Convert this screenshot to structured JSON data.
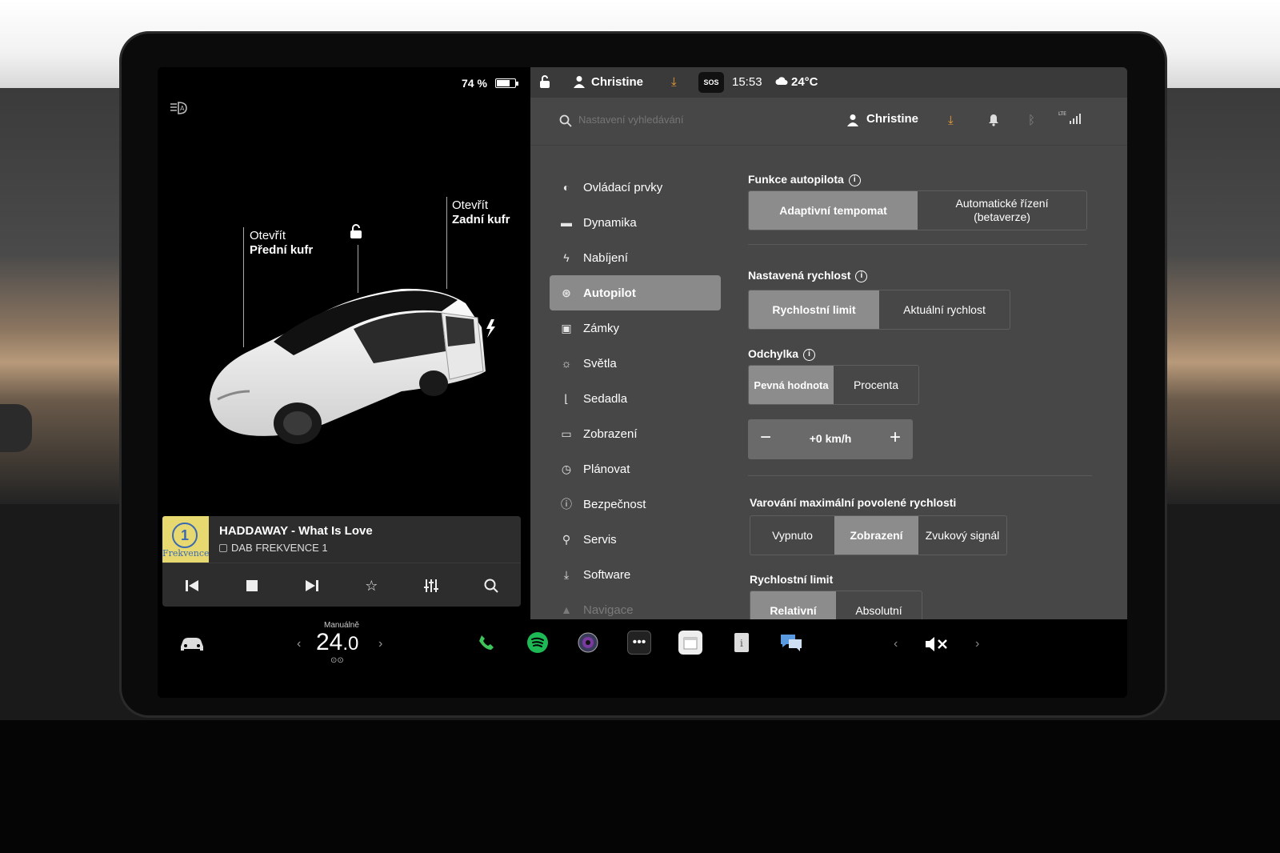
{
  "status": {
    "battery_percent": "74 %",
    "battery_level": 0.74,
    "user": "Christine",
    "sos": "SOS",
    "time": "15:53",
    "outside_temp": "24°C"
  },
  "car_view": {
    "front_trunk": {
      "action": "Otevřít",
      "name": "Přední kufr"
    },
    "rear_trunk": {
      "action": "Otevřít",
      "name": "Zadní kufr"
    }
  },
  "media": {
    "art_logo": "1",
    "art_brand": "Frekvence",
    "title": "HADDAWAY - What Is Love",
    "station": "DAB FREKVENCE 1"
  },
  "search": {
    "placeholder": "Nastavení vyhledávání"
  },
  "header": {
    "user": "Christine",
    "lte": "LTE"
  },
  "nav": [
    {
      "label": "Ovládací prvky",
      "icon": "toggle-icon"
    },
    {
      "label": "Dynamika",
      "icon": "car-icon"
    },
    {
      "label": "Nabíjení",
      "icon": "bolt-icon"
    },
    {
      "label": "Autopilot",
      "icon": "steering-wheel-icon",
      "active": true
    },
    {
      "label": "Zámky",
      "icon": "lock-icon"
    },
    {
      "label": "Světla",
      "icon": "sun-icon"
    },
    {
      "label": "Sedadla",
      "icon": "seat-icon"
    },
    {
      "label": "Zobrazení",
      "icon": "display-icon"
    },
    {
      "label": "Plánovat",
      "icon": "alarm-clock-icon"
    },
    {
      "label": "Bezpečnost",
      "icon": "shield-alert-icon"
    },
    {
      "label": "Servis",
      "icon": "wrench-icon"
    },
    {
      "label": "Software",
      "icon": "download-icon"
    },
    {
      "label": "Navigace",
      "icon": "navigation-icon"
    }
  ],
  "autopilot": {
    "features_title": "Funkce autopilota",
    "features_options": [
      "Adaptivní tempomat",
      "Automatické řízení (betaverze)"
    ],
    "features_selected": 0,
    "set_speed_title": "Nastavená rychlost",
    "set_speed_options": [
      "Rychlostní limit",
      "Aktuální rychlost"
    ],
    "set_speed_selected": 0,
    "offset_title": "Odchylka",
    "offset_options": [
      "Pevná hodnota",
      "Procenta"
    ],
    "offset_selected": 0,
    "offset_value": "+0 km/h",
    "warning_title": "Varování maximální povolené rychlosti",
    "warning_options": [
      "Vypnuto",
      "Zobrazení",
      "Zvukový signál"
    ],
    "warning_selected": 1,
    "limit_title": "Rychlostní limit",
    "limit_options": [
      "Relativní",
      "Absolutní"
    ],
    "limit_selected": 0
  },
  "climate": {
    "mode": "Manuálně",
    "temp_int": "24",
    "temp_dec": ".0"
  },
  "colors": {
    "accent_orange": "#f0a030",
    "spotify_green": "#1db954",
    "phone_green": "#3ec45a",
    "selected_segment": "#8c8c8c",
    "panel_bg": "#474747"
  }
}
